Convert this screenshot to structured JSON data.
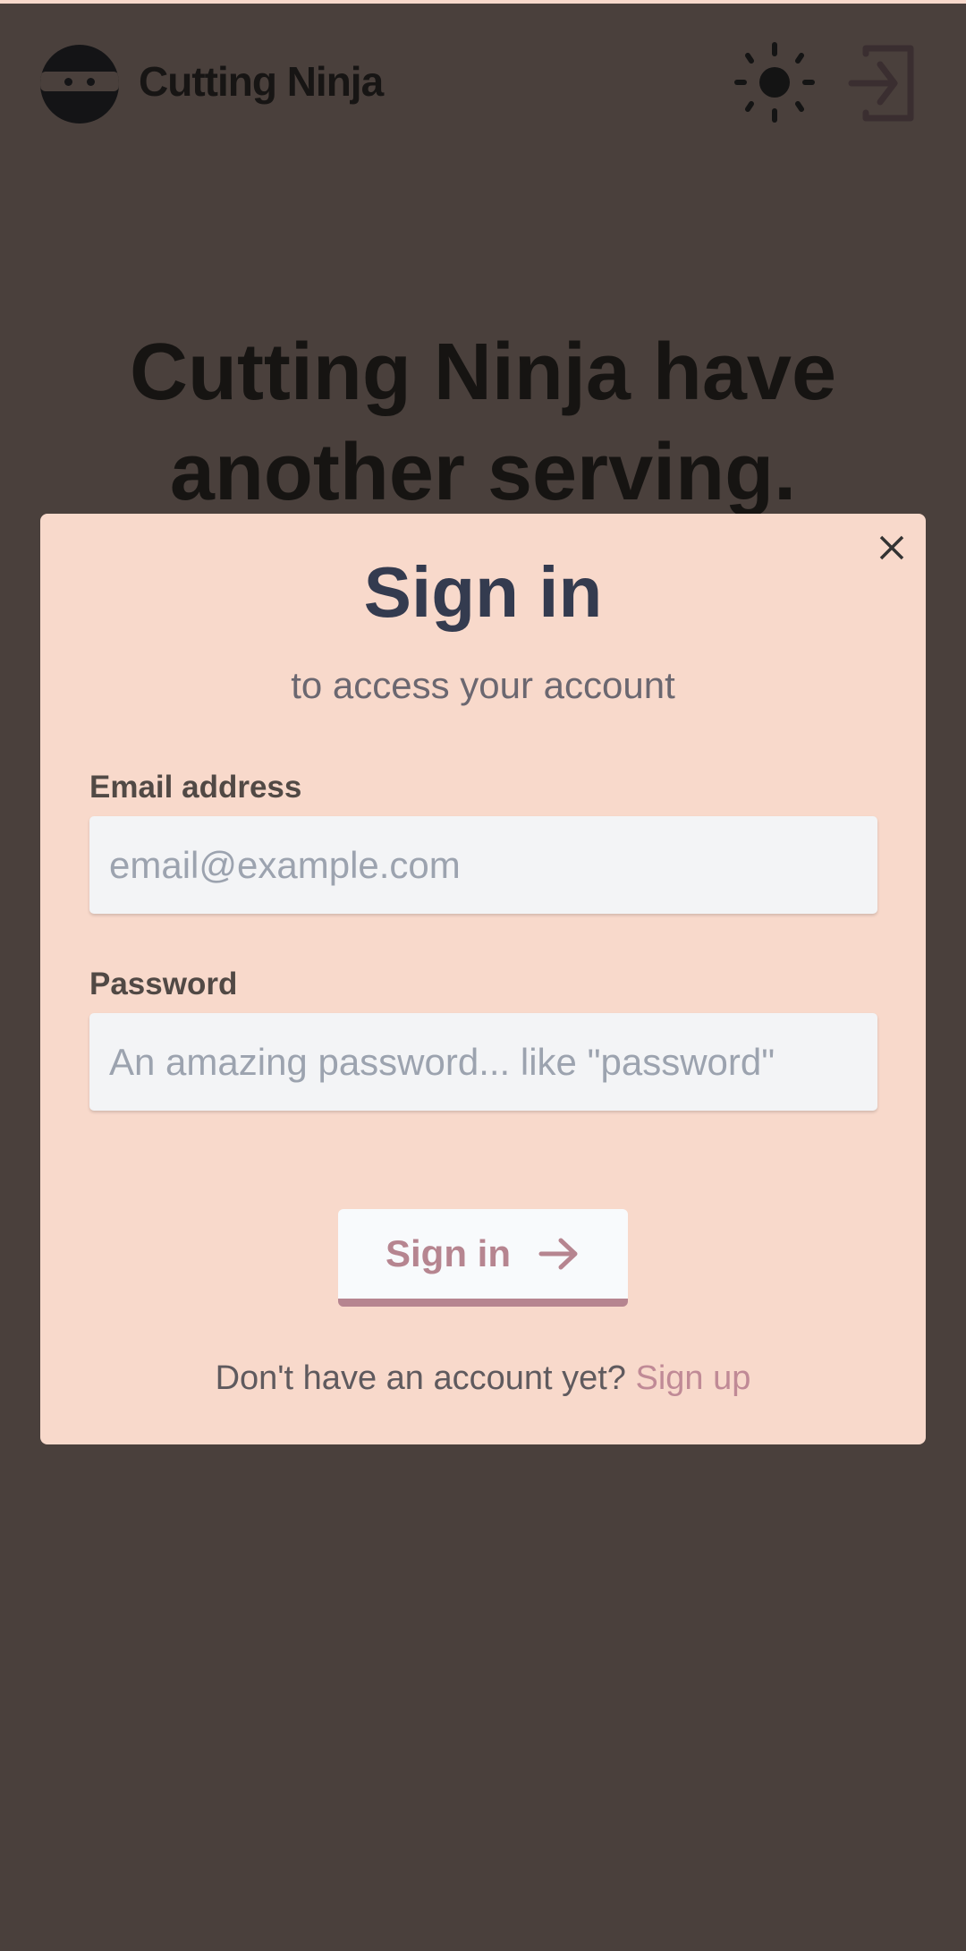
{
  "header": {
    "brand": "Cutting Ninja",
    "theme_icon": "sun-icon",
    "login_icon": "login-icon"
  },
  "hero": {
    "line1": "Cutting Ninja have",
    "line2": "another serving."
  },
  "modal": {
    "title": "Sign in",
    "subtitle": "to access your account",
    "email_label": "Email address",
    "email_placeholder": "email@example.com",
    "password_label": "Password",
    "password_placeholder": "An amazing password... like \"password\"",
    "submit_label": "Sign in",
    "footer_text": "Don't have an account yet?",
    "signup_link": "Sign up"
  },
  "colors": {
    "background": "#4a403c",
    "modal": "#f8d9cb",
    "accent": "#b68590",
    "title": "#343b4f"
  }
}
